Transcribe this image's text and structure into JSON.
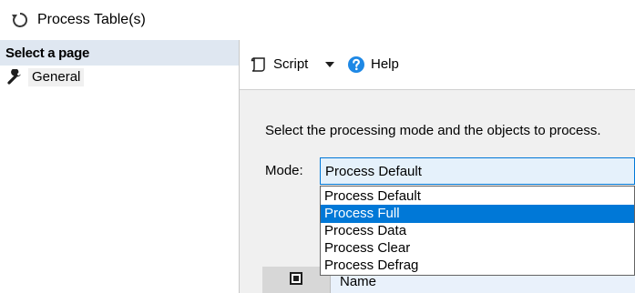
{
  "window": {
    "title": "Process Table(s)",
    "icon": "refresh-icon"
  },
  "left_pane": {
    "header": "Select a page",
    "pages": [
      {
        "label": "General",
        "icon": "wrench-icon"
      }
    ]
  },
  "toolbar": {
    "script_label": "Script",
    "script_icon": "script-icon",
    "dropdown_icon": "chevron-down-icon",
    "help_label": "Help",
    "help_icon": "help-icon"
  },
  "content": {
    "instructions": "Select the processing mode and the objects to process.",
    "mode_label": "Mode:",
    "mode_value": "Process Default",
    "mode_options": [
      {
        "label": "Process Default",
        "selected": false
      },
      {
        "label": "Process Full",
        "selected": true
      },
      {
        "label": "Process Data",
        "selected": false
      },
      {
        "label": "Process Clear",
        "selected": false
      },
      {
        "label": "Process Defrag",
        "selected": false
      }
    ],
    "grid": {
      "name_header": "Name"
    }
  },
  "colors": {
    "accent": "#0078d7",
    "help_icon": "#1e88e5",
    "pane_header": "#dfe7f1",
    "panel_background": "#f0f0f0"
  }
}
